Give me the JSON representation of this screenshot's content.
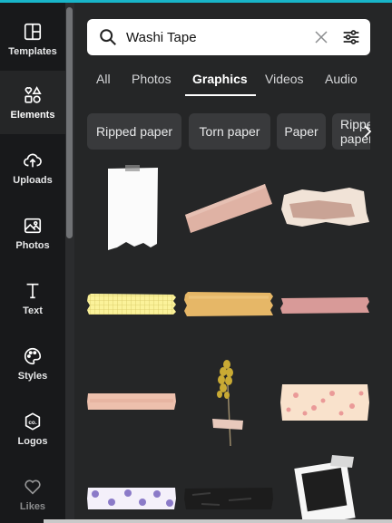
{
  "sidebar": {
    "items": [
      {
        "label": "Templates",
        "icon": "templates-icon"
      },
      {
        "label": "Elements",
        "icon": "elements-icon",
        "active": true
      },
      {
        "label": "Uploads",
        "icon": "upload-cloud-icon"
      },
      {
        "label": "Photos",
        "icon": "photo-icon"
      },
      {
        "label": "Text",
        "icon": "text-icon"
      },
      {
        "label": "Styles",
        "icon": "palette-icon"
      },
      {
        "label": "Logos",
        "icon": "logo-icon"
      },
      {
        "label": "Likes",
        "icon": "heart-icon"
      }
    ]
  },
  "search": {
    "value": "Washi Tape",
    "icons": [
      "search-icon",
      "clear-icon",
      "filter-icon"
    ]
  },
  "tabs": [
    {
      "label": "All"
    },
    {
      "label": "Photos"
    },
    {
      "label": "Graphics",
      "active": true
    },
    {
      "label": "Videos"
    },
    {
      "label": "Audio"
    }
  ],
  "chips": [
    {
      "label": "Ripped paper"
    },
    {
      "label": "Torn paper"
    },
    {
      "label": "Paper"
    },
    {
      "label": "Ripped paper"
    }
  ],
  "colors": {
    "accent": "#18b5c9",
    "sidebar_bg": "#18191b",
    "panel_bg": "#252627",
    "chip_bg": "#393a3c"
  }
}
